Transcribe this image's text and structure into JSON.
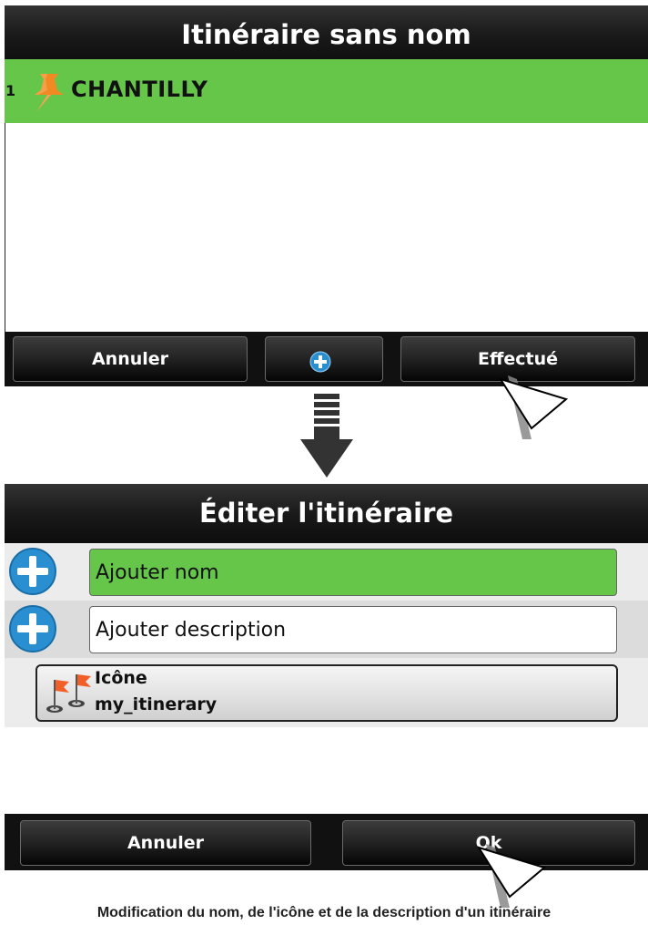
{
  "screen1": {
    "title": "Itinéraire sans nom",
    "items": [
      {
        "index": "1",
        "name": "CHANTILLY",
        "icon": "pushpin-icon"
      }
    ],
    "buttons": {
      "cancel": "Annuler",
      "add_icon": "plus-icon",
      "done": "Effectué"
    }
  },
  "transition_icon": "down-arrow-icon",
  "screen2": {
    "title": "Éditer l'itinéraire",
    "name_field": {
      "value": "Ajouter nom"
    },
    "description_field": {
      "value": "Ajouter description"
    },
    "icon_selector": {
      "label": "Icône",
      "value": "my_itinerary",
      "icon": "flags-icon"
    },
    "buttons": {
      "cancel": "Annuler",
      "ok": "Ok"
    }
  },
  "caption": "Modification du nom, de l'icône et de la description d'un itinéraire",
  "colors": {
    "selected_green": "#66c64a",
    "plus_blue": "#2a8fd0",
    "pin_orange": "#f28a23"
  }
}
